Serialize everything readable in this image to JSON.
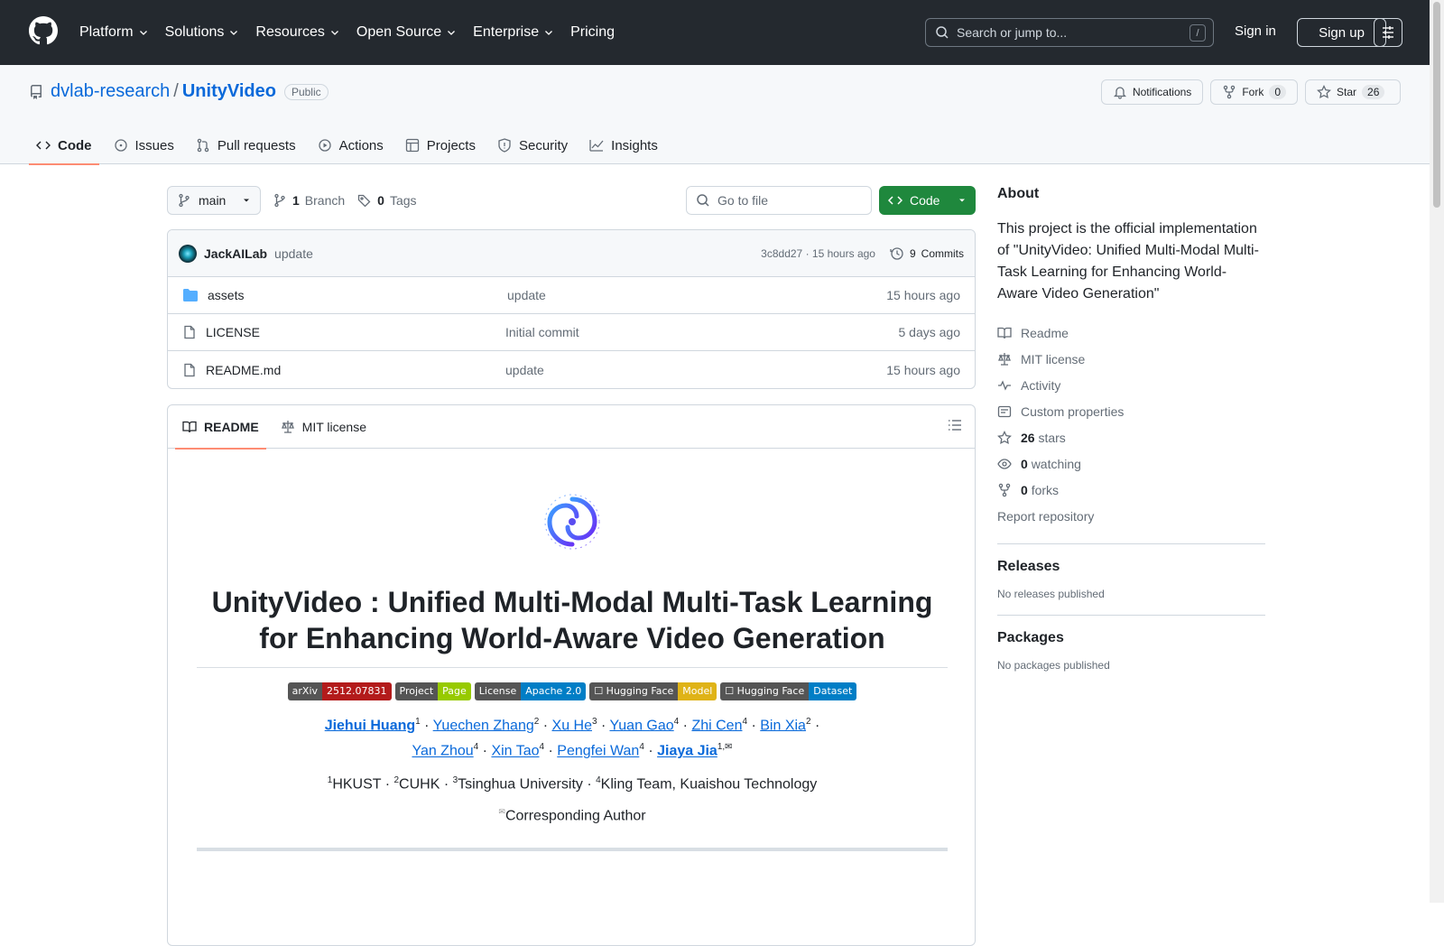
{
  "header": {
    "nav": [
      "Platform",
      "Solutions",
      "Resources",
      "Open Source",
      "Enterprise",
      "Pricing"
    ],
    "nav_has_chevron": [
      true,
      true,
      true,
      true,
      true,
      false
    ],
    "search_placeholder": "Search or jump to...",
    "search_shortcut": "/",
    "signin": "Sign in",
    "signup": "Sign up"
  },
  "repo": {
    "owner": "dvlab-research",
    "separator": "/",
    "name": "UnityVideo",
    "visibility": "Public",
    "notifications_label": "Notifications",
    "fork_label": "Fork",
    "fork_count": "0",
    "star_label": "Star",
    "star_count": "26",
    "tabs": [
      "Code",
      "Issues",
      "Pull requests",
      "Actions",
      "Projects",
      "Security",
      "Insights"
    ]
  },
  "code": {
    "branch": "main",
    "branch_count": "1",
    "branch_label": "Branch",
    "tag_count": "0",
    "tag_label": "Tags",
    "goto_placeholder": "Go to file",
    "code_button": "Code"
  },
  "latest_commit": {
    "author": "JackAILab",
    "message": "update",
    "hash": "3c8dd27",
    "time": "15 hours ago",
    "dot": "·",
    "commits_count": "9",
    "commits_label": "Commits"
  },
  "files": [
    {
      "name": "assets",
      "type": "folder",
      "message": "update",
      "time": "15 hours ago"
    },
    {
      "name": "LICENSE",
      "type": "file",
      "message": "Initial commit",
      "time": "5 days ago"
    },
    {
      "name": "README.md",
      "type": "file",
      "message": "update",
      "time": "15 hours ago"
    }
  ],
  "readme": {
    "tabs": [
      "README",
      "MIT license"
    ],
    "title_line1": "UnityVideo : Unified Multi-Modal Multi-Task Learning",
    "title_line2": "for Enhancing World-Aware Video Generation",
    "badges": [
      {
        "left": "arXiv",
        "right": "2512.07831",
        "left_color": "#555555",
        "right_color": "#b31b1b"
      },
      {
        "left": "Project",
        "right": "Page",
        "left_color": "#555555",
        "right_color": "#97ca00"
      },
      {
        "left": "License",
        "right": "Apache 2.0",
        "left_color": "#555555",
        "right_color": "#007ec6"
      },
      {
        "left": "☐ Hugging Face",
        "right": "Model",
        "left_color": "#555555",
        "right_color": "#dfb317"
      },
      {
        "left": "☐ Hugging Face",
        "right": "Dataset",
        "left_color": "#555555",
        "right_color": "#007ec6"
      }
    ],
    "authors_line1": [
      {
        "name": "Jiehui Huang",
        "sup": "1",
        "bold": true
      },
      {
        "name": "Yuechen Zhang",
        "sup": "2",
        "bold": false
      },
      {
        "name": "Xu He",
        "sup": "3",
        "bold": false
      },
      {
        "name": "Yuan Gao",
        "sup": "4",
        "bold": false
      },
      {
        "name": "Zhi Cen",
        "sup": "4",
        "bold": false
      },
      {
        "name": "Bin Xia",
        "sup": "2",
        "bold": false
      }
    ],
    "authors_line2": [
      {
        "name": "Yan Zhou",
        "sup": "4",
        "bold": false
      },
      {
        "name": "Xin Tao",
        "sup": "4",
        "bold": false
      },
      {
        "name": "Pengfei Wan",
        "sup": "4",
        "bold": false
      },
      {
        "name": "Jiaya Jia",
        "sup": "1,✉",
        "bold": true
      }
    ],
    "affiliations": [
      {
        "sup": "1",
        "name": "HKUST"
      },
      {
        "sup": "2",
        "name": "CUHK"
      },
      {
        "sup": "3",
        "name": "Tsinghua University"
      },
      {
        "sup": "4",
        "name": "Kling Team, Kuaishou Technology"
      }
    ],
    "author_separator": " · ",
    "corresponding_mark": "✉",
    "corresponding": "Corresponding Author"
  },
  "about": {
    "heading": "About",
    "description": "This project is the official implementation of \"UnityVideo: Unified Multi-Modal Multi-Task Learning for Enhancing World-Aware Video Generation\"",
    "readme": "Readme",
    "license": "MIT license",
    "activity": "Activity",
    "custom_properties": "Custom properties",
    "stars_count": "26",
    "stars_label": "stars",
    "watching_count": "0",
    "watching_label": "watching",
    "forks_count": "0",
    "forks_label": "forks",
    "report": "Report repository"
  },
  "releases": {
    "heading": "Releases",
    "empty": "No releases published"
  },
  "packages": {
    "heading": "Packages",
    "empty": "No packages published"
  },
  "colors": {
    "accent": "#0969da",
    "header_bg": "#24292f",
    "primary_button": "#1f883d",
    "active_tab": "#fd8c73"
  }
}
